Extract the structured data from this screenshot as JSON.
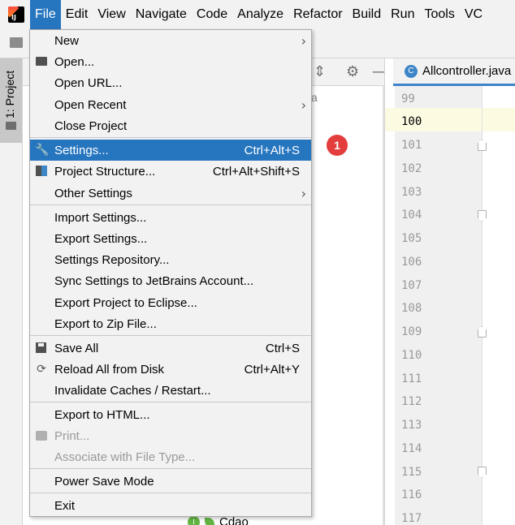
{
  "menubar": {
    "items": [
      "File",
      "Edit",
      "View",
      "Navigate",
      "Code",
      "Analyze",
      "Refactor",
      "Build",
      "Run",
      "Tools",
      "VC"
    ]
  },
  "tool_strip": {
    "project_tab": "1: Project"
  },
  "project_panel": {
    "tree_text": "a",
    "tree_item": "Cdao"
  },
  "editor": {
    "tab_label": "Allcontroller.java",
    "line_numbers": [
      "99",
      "100",
      "101",
      "102",
      "103",
      "104",
      "105",
      "106",
      "107",
      "108",
      "109",
      "110",
      "111",
      "112",
      "113",
      "114",
      "115",
      "116",
      "117"
    ],
    "current_line": "100"
  },
  "file_menu": {
    "new": "New",
    "open": "Open...",
    "open_url": "Open URL...",
    "open_recent": "Open Recent",
    "close_project": "Close Project",
    "settings": "Settings...",
    "settings_shortcut": "Ctrl+Alt+S",
    "project_structure": "Project Structure...",
    "project_structure_shortcut": "Ctrl+Alt+Shift+S",
    "other_settings": "Other Settings",
    "import_settings": "Import Settings...",
    "export_settings": "Export Settings...",
    "settings_repository": "Settings Repository...",
    "sync_settings": "Sync Settings to JetBrains Account...",
    "export_eclipse": "Export Project to Eclipse...",
    "export_zip": "Export to Zip File...",
    "save_all": "Save All",
    "save_all_shortcut": "Ctrl+S",
    "reload_all": "Reload All from Disk",
    "reload_all_shortcut": "Ctrl+Alt+Y",
    "invalidate_caches": "Invalidate Caches / Restart...",
    "export_html": "Export to HTML...",
    "print": "Print...",
    "associate": "Associate with File Type...",
    "power_save": "Power Save Mode",
    "exit": "Exit"
  },
  "annotation_badge": "1",
  "colors": {
    "accent": "#2675bf",
    "badge": "#e33d3d",
    "caret_row": "#fcfae1"
  }
}
